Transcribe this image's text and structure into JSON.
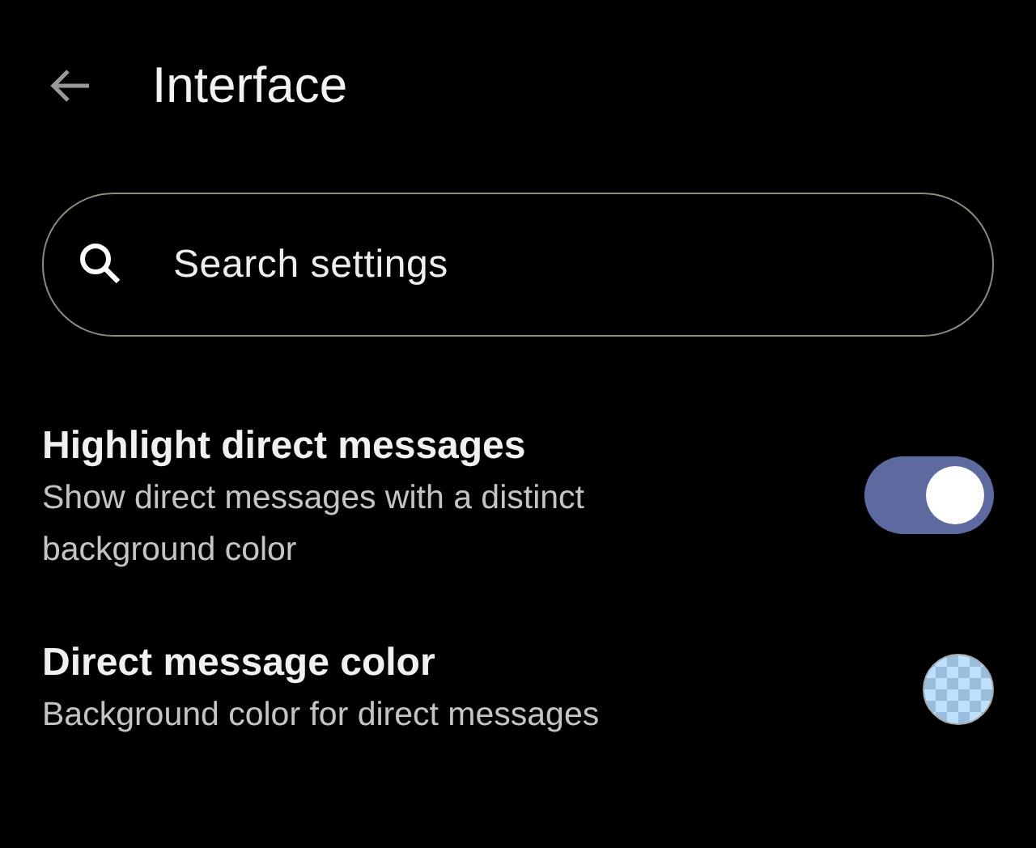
{
  "header": {
    "title": "Interface"
  },
  "search": {
    "placeholder": "Search settings"
  },
  "settings": [
    {
      "kind": "toggle",
      "title": "Highlight direct messages",
      "summary": "Show direct messages with a distinct background color",
      "on": true
    },
    {
      "kind": "color",
      "title": "Direct message color",
      "summary": "Background color for direct messages",
      "color": "#bde0fe"
    }
  ]
}
